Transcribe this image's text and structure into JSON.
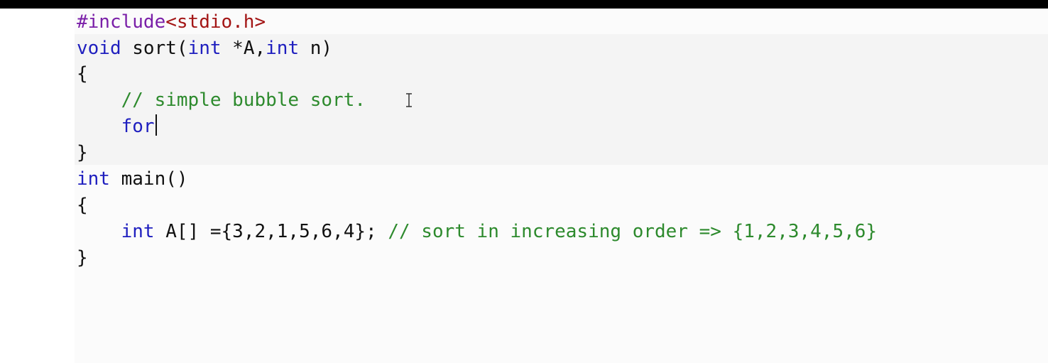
{
  "editor": {
    "lines": [
      {
        "parts": [
          "#include",
          "<stdio.h>"
        ]
      },
      {
        "parts": [
          "void",
          " sort(",
          "int",
          " *A,",
          "int",
          " n)"
        ]
      },
      {
        "parts": [
          "{"
        ]
      },
      {
        "parts": [
          "    ",
          "// simple bubble sort."
        ]
      },
      {
        "parts": [
          "    ",
          "for"
        ]
      },
      {
        "parts": [
          "}"
        ]
      },
      {
        "parts": [
          "int",
          " main()"
        ]
      },
      {
        "parts": [
          "{"
        ]
      },
      {
        "parts": [
          "    ",
          "int",
          " A[] ={3,2,1,5,6,4}; ",
          "// sort in increasing order => {1,2,3,4,5,6}"
        ]
      },
      {
        "parts": [
          "}"
        ]
      }
    ]
  },
  "colors": {
    "keyword": "#1f1fbf",
    "preprocessor": "#7a1fa8",
    "include_path": "#a31515",
    "comment": "#2d8a2d",
    "text": "#111111"
  },
  "icons": {
    "text_cursor": "ibeam-cursor-icon"
  }
}
